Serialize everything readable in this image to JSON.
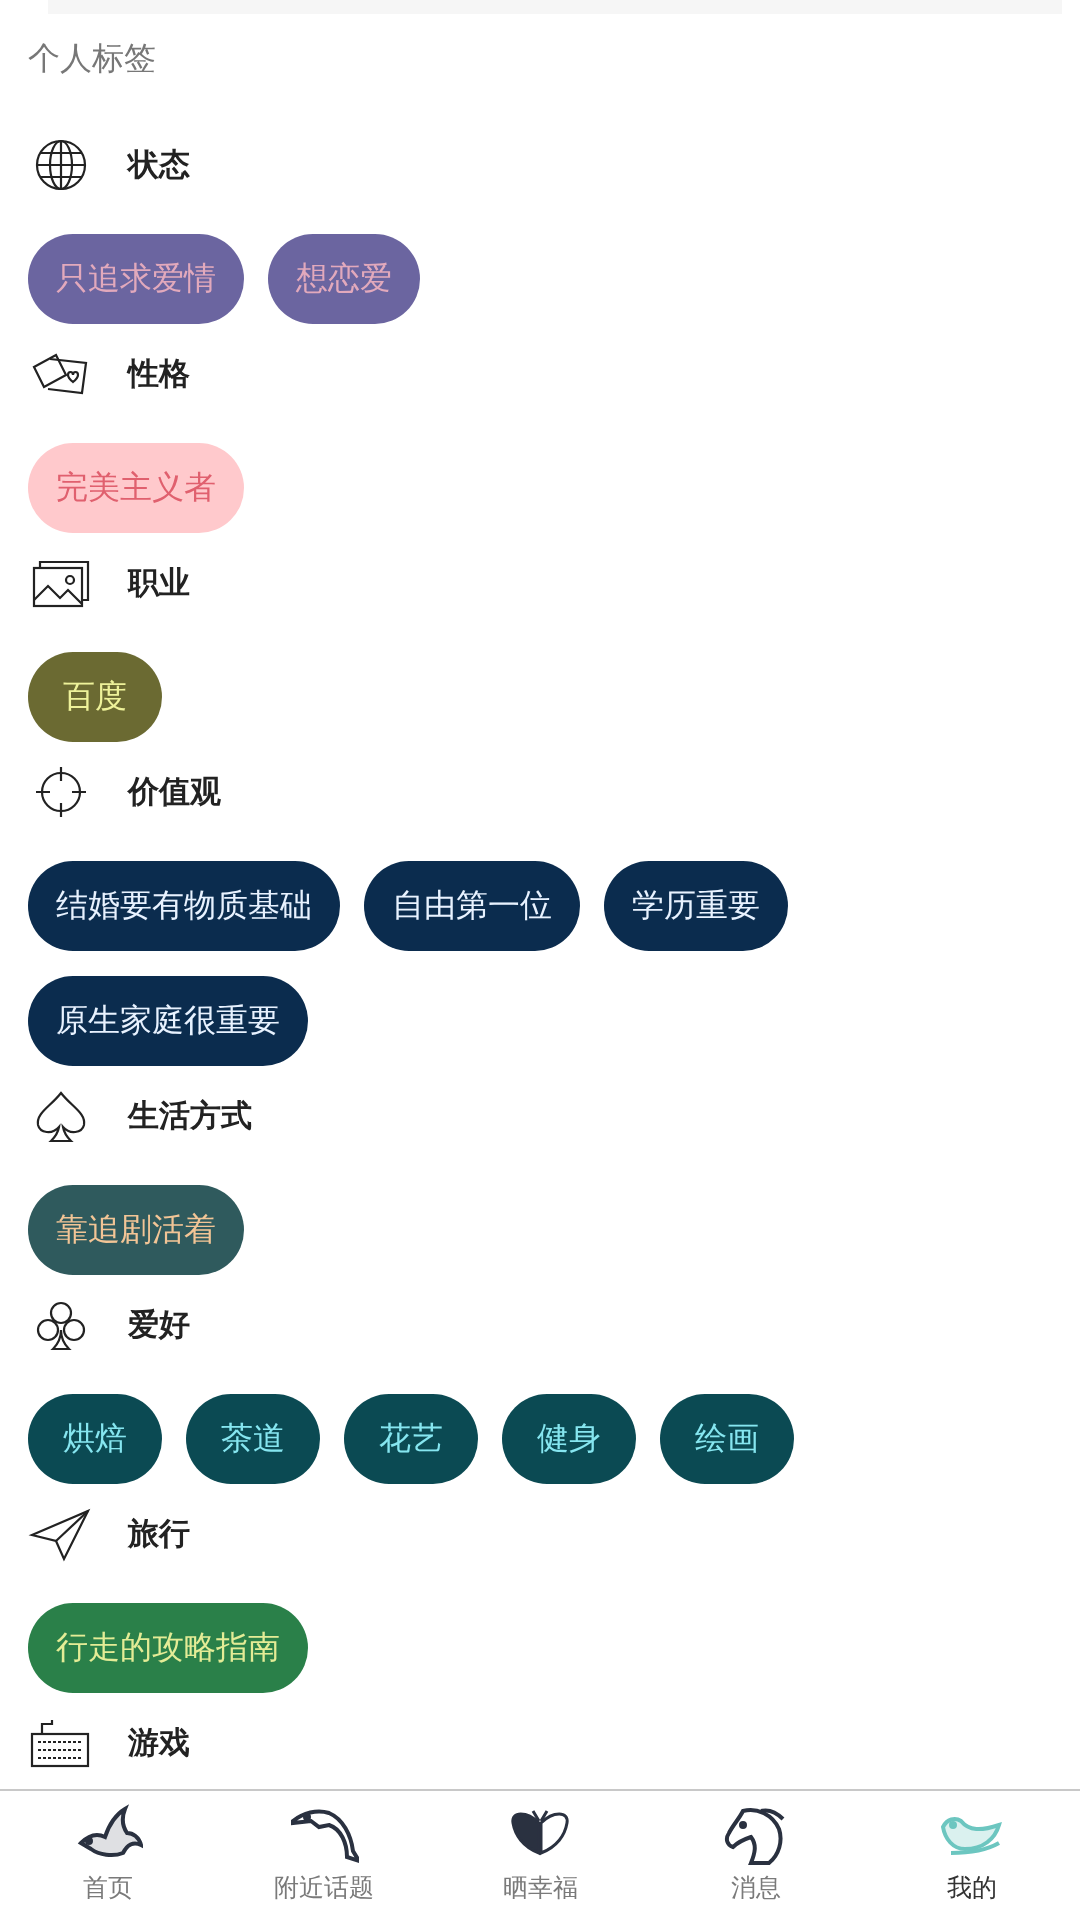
{
  "title": "个人标签",
  "sections": [
    {
      "name": "状态",
      "color": "#6b65a0",
      "tags": [
        "只追求爱情",
        "想恋爱"
      ]
    },
    {
      "name": "性格",
      "color": "#ffc9cc",
      "tags": [
        "完美主义者"
      ]
    },
    {
      "name": "职业",
      "color": "#6b6a32",
      "tags": [
        "百度"
      ]
    },
    {
      "name": "价值观",
      "color": "#0b2c4e",
      "tags": [
        "结婚要有物质基础",
        "自由第一位",
        "学历重要",
        "原生家庭很重要"
      ]
    },
    {
      "name": "生活方式",
      "color": "#2f5a5d",
      "tags": [
        "靠追剧活着"
      ]
    },
    {
      "name": "爱好",
      "color": "#0b4a53",
      "tags": [
        "烘焙",
        "茶道",
        "花艺",
        "健身",
        "绘画"
      ]
    },
    {
      "name": "旅行",
      "color": "#2a8049",
      "tags": [
        "行走的攻略指南"
      ]
    },
    {
      "name": "游戏"
    }
  ],
  "nav": [
    {
      "label": "首页",
      "selected": false
    },
    {
      "label": "附近话题",
      "selected": false
    },
    {
      "label": "晒幸福",
      "selected": false
    },
    {
      "label": "消息",
      "selected": false
    },
    {
      "label": "我的",
      "selected": true
    }
  ]
}
